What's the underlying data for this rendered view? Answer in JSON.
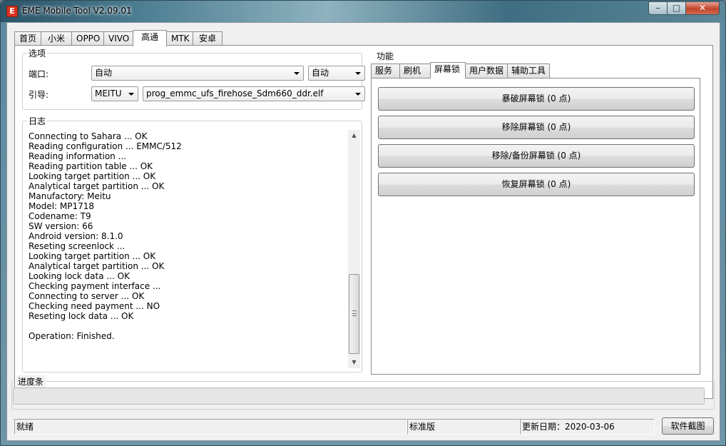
{
  "window": {
    "title": "EME Mobile Tool V2.09.01",
    "app_icon_glyph": "E",
    "controls": {
      "minimize": "–",
      "maximize": "□",
      "close": "✕"
    }
  },
  "top_tabs": [
    "首页",
    "小米",
    "OPPO",
    "VIVO",
    "高通",
    "MTK",
    "安卓"
  ],
  "active_top_tab": "高通",
  "options": {
    "legend": "选项",
    "port_label": "端口:",
    "port_value": "自动",
    "port_mode_value": "自动",
    "boot_label": "引导:",
    "brand_value": "MEITU",
    "loader_value": "prog_emmc_ufs_firehose_Sdm660_ddr.elf"
  },
  "log": {
    "legend": "日志",
    "lines": [
      "Connecting to Sahara ... OK",
      "Reading configuration ... EMMC/512",
      "Reading information ...",
      "Reading partition table ... OK",
      "Looking target partition ... OK",
      "Analytical target partition ... OK",
      "Manufactory: Meitu",
      "Model: MP1718",
      "Codename: T9",
      "SW version: 66",
      "Android version: 8.1.0",
      "Reseting screenlock ...",
      "Looking target partition ... OK",
      "Analytical target partition ... OK",
      "Looking lock data ... OK",
      "Checking payment interface ...",
      "Connecting to server ... OK",
      "Checking need payment ... NO",
      "Reseting lock data ... OK",
      "",
      "Operation: Finished."
    ]
  },
  "functions": {
    "legend": "功能",
    "tabs": [
      "服务",
      "刷机",
      "屏幕锁",
      "用户数据",
      "辅助工具"
    ],
    "active_tab": "屏幕锁",
    "buttons": [
      "暴破屏幕锁 (0 点)",
      "移除屏幕锁 (0 点)",
      "移除/备份屏幕锁 (0 点)",
      "恢复屏幕锁 (0 点)"
    ]
  },
  "progress": {
    "legend": "进度条",
    "value": 0
  },
  "status": {
    "ready": "就绪",
    "edition": "标准版",
    "update_date": "更新日期：2020-03-06"
  },
  "screenshot_button": "软件截图"
}
